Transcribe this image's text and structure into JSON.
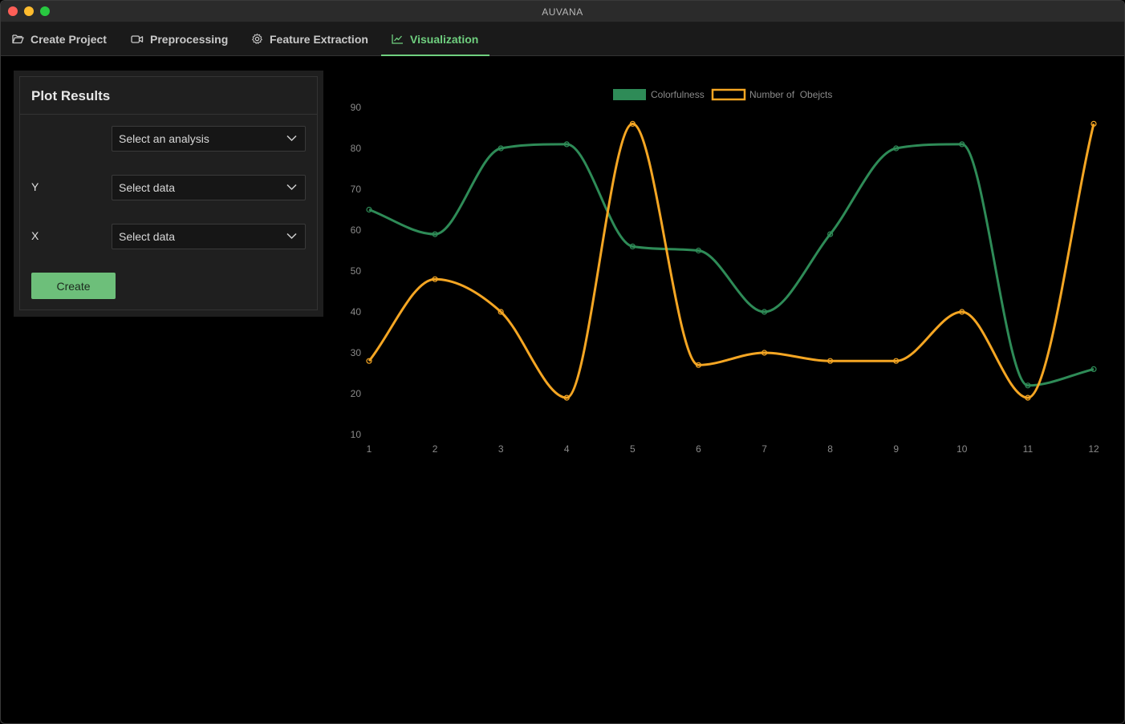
{
  "window": {
    "title": "AUVANA"
  },
  "tabs": [
    {
      "label": "Create Project",
      "icon": "folder-open-icon"
    },
    {
      "label": "Preprocessing",
      "icon": "video-camera-icon"
    },
    {
      "label": "Feature Extraction",
      "icon": "gear-icon"
    },
    {
      "label": "Visualization",
      "icon": "line-chart-icon",
      "active": true
    }
  ],
  "panel": {
    "title": "Plot Results",
    "analysis_select": {
      "value": "Select an analysis"
    },
    "y": {
      "label": "Y",
      "value": "Select data"
    },
    "x": {
      "label": "X",
      "value": "Select data"
    },
    "create_label": "Create"
  },
  "colors": {
    "accent": "#6fcf7f",
    "series1": "#2e8b57",
    "series2": "#f5a623"
  },
  "chart_data": {
    "type": "line",
    "x": [
      1,
      2,
      3,
      4,
      5,
      6,
      7,
      8,
      9,
      10,
      11,
      12
    ],
    "series": [
      {
        "name": "Colorfulness",
        "color": "#2e8b57",
        "legend_style": "filled",
        "values": [
          65,
          59,
          80,
          81,
          56,
          55,
          40,
          59,
          80,
          81,
          22,
          26
        ]
      },
      {
        "name": "Number of  Obejcts",
        "color": "#f5a623",
        "legend_style": "outline",
        "values": [
          28,
          48,
          40,
          19,
          86,
          27,
          30,
          28,
          28,
          40,
          19,
          86
        ]
      }
    ],
    "ylim": [
      10,
      90
    ],
    "yticks": [
      10,
      20,
      30,
      40,
      50,
      60,
      70,
      80,
      90
    ],
    "xlim": [
      1,
      12
    ],
    "grid": false,
    "legend": "top-center",
    "smooth": true
  }
}
